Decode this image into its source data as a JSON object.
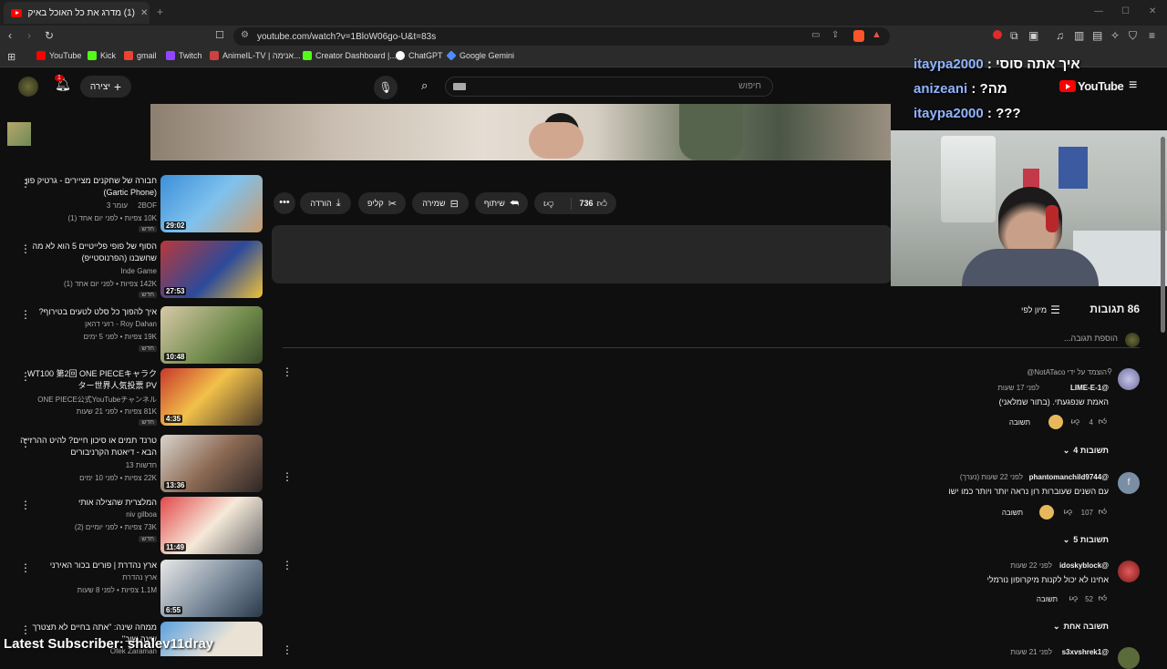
{
  "browser": {
    "tab_title": "(1) מדרג את כל האוכל באיקאה",
    "new_tab": "+",
    "url": "youtube.com/watch?v=1BloW06go-U&t=83s",
    "bookmarks": [
      {
        "label": "YouTube",
        "color": "#ff0000"
      },
      {
        "label": "Kick",
        "color": "#53fc18"
      },
      {
        "label": "gmail",
        "color": "#ea4335"
      },
      {
        "label": "Twitch",
        "color": "#9146ff"
      },
      {
        "label": "AnimeIL-TV | אנימה...",
        "color": "#d04040"
      },
      {
        "label": "Creator Dashboard |...",
        "color": "#53fc18"
      },
      {
        "label": "ChatGPT",
        "color": "#ffffff"
      },
      {
        "label": "Google Gemini",
        "color": "#4e8cff"
      }
    ]
  },
  "youtube": {
    "notification_count": "1",
    "create_label": "יצירה",
    "search_placeholder": "חיפוש",
    "logo_text": "YouTube"
  },
  "actions": {
    "like_count": "736",
    "share": "שיתוף",
    "save": "שמירה",
    "clip": "קליפ",
    "download": "הורדה"
  },
  "comments": {
    "count_label": "86 תגובות",
    "sort_label": "מיון לפי",
    "add_placeholder": "הוספת תגובה...",
    "items": [
      {
        "pinned": "הוצמד על ידי NotATaco@",
        "author": "LIME-E-1@",
        "time": "לפני 17 שעות",
        "text": "האמת שנפגעתי. (בתור שמלאני)",
        "likes": "4",
        "reply": "תשובה",
        "replies": "4 תשובות"
      },
      {
        "author": "phantomanchild9744@",
        "time": "לפני 22 שעות (נערך)",
        "text": "עם השנים שעוברות רון נראה יותר ויותר כמו ישו",
        "likes": "107",
        "reply": "תשובה",
        "replies": "5 תשובות"
      },
      {
        "author": "idoskyblock@",
        "time": "לפני 22 שעות",
        "text": "אחינו לא יכול לקנות מיקרופון נורמלי",
        "likes": "52",
        "reply": "תשובה",
        "replies": "תשובה אחת"
      },
      {
        "author": "s3xvshrek1@",
        "time": "לפני 21 שעות"
      }
    ]
  },
  "sidebar": [
    {
      "title": "חבורה של שחקנים מציירים - גרטיק פון (Gartic Phone)",
      "channel": "עומר 3",
      "meta": "10K צפיות • לפני יום אחד (1)",
      "badge": "חדש",
      "duration": "29:02",
      "extra": "2BOF"
    },
    {
      "title": "הסוף של פופי פלייטיים 5 הוא לא מה שחשבנו (הפרנוסטייפ)",
      "channel": "Inde Game",
      "meta": "142K צפיות • לפני יום אחד (1)",
      "badge": "חדש",
      "duration": "27:53"
    },
    {
      "title": "איך להפוך כל סלט לטעים בטירוף?",
      "channel": "רועי דהאן - Roy Dahan",
      "meta": "19K צפיות • לפני 5 ימים",
      "badge": "חדש",
      "duration": "10:48"
    },
    {
      "title": "WT100 第2回 ONE PIECEキャラクター世界人気投票 PV",
      "channel": "ONE PIECE公式YouTubeチャンネル",
      "meta": "81K צפיות • לפני 21 שעות",
      "badge": "חדש",
      "duration": "4:35"
    },
    {
      "title": "טרנד תמים או סיכון חיים? להיט ההרזייה הבא - דיאטת הקרניבורים",
      "channel": "חדשות 13",
      "meta": "22K צפיות • לפני 10 ימים",
      "badge": "",
      "duration": "13:36"
    },
    {
      "title": "המלצרית שהצילה אותי",
      "channel": "niv gilboa",
      "meta": "73K צפיות • לפני יומיים (2)",
      "badge": "חדש",
      "duration": "11:49"
    },
    {
      "title": "ארץ נהדרת | פורים בכור האירני",
      "channel": "ארץ נהדרת",
      "meta": "1.1M צפיות • לפני 8 שעות",
      "badge": "",
      "duration": "6:55"
    },
    {
      "title": "ממחה שינה: \"אתה בחיים לא תצטרך שינה שוב\"",
      "channel": "Ofek Zaraman",
      "meta": "",
      "badge": "",
      "duration": ""
    }
  ],
  "overlays": {
    "chat": [
      {
        "user": "itaypa2000",
        "message": "איך אתה סוסי",
        "color": "#8fb4ff"
      },
      {
        "user": "anizeani",
        "message": "?מה",
        "color": "#8fb4ff"
      },
      {
        "user": "itaypa2000",
        "message": "???",
        "color": "#8fb4ff"
      }
    ],
    "latest_subscriber": "Latest Subscriber: shalev11dray"
  }
}
